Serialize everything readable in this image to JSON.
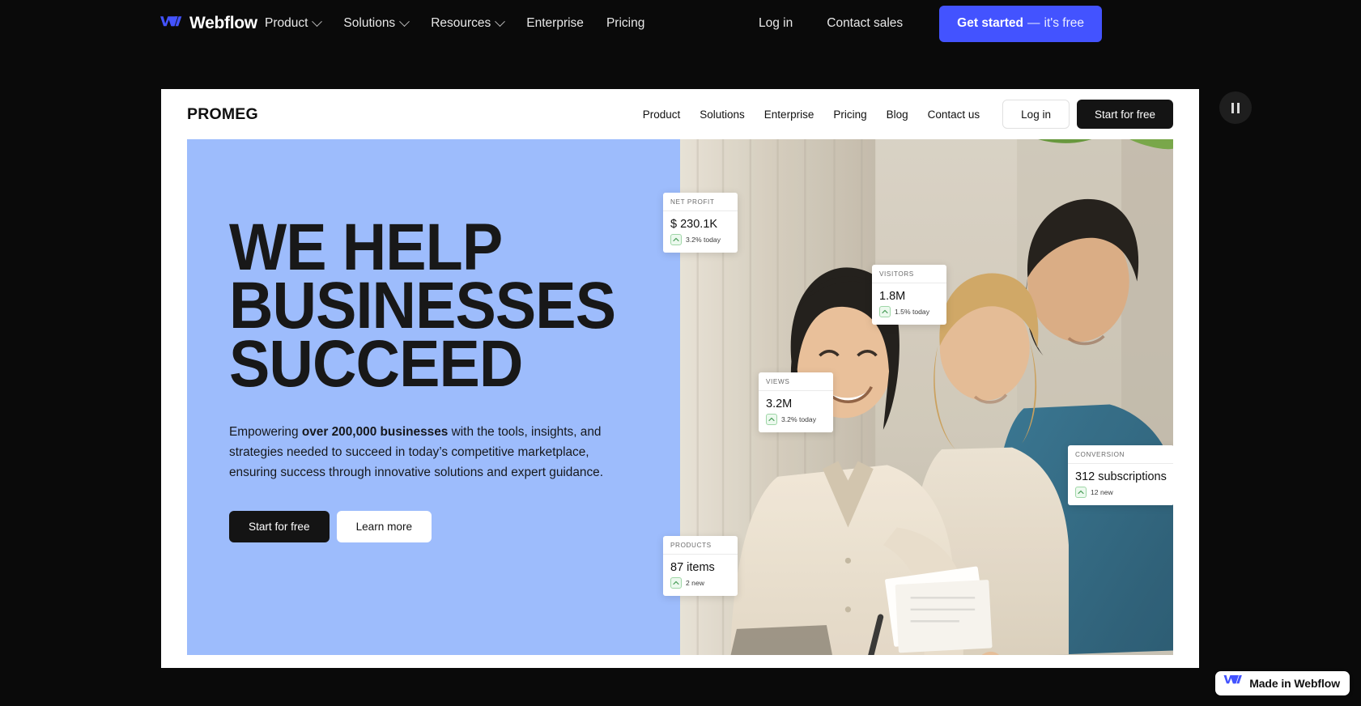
{
  "webflow_nav": {
    "logo_text": "Webflow",
    "links": [
      {
        "label": "Product",
        "has_chevron": true
      },
      {
        "label": "Solutions",
        "has_chevron": true
      },
      {
        "label": "Resources",
        "has_chevron": true
      },
      {
        "label": "Enterprise",
        "has_chevron": false
      },
      {
        "label": "Pricing",
        "has_chevron": false
      }
    ],
    "login_label": "Log in",
    "contact_label": "Contact sales",
    "cta_bold": "Get started",
    "cta_dash": "—",
    "cta_rest": "it's free",
    "accent_color": "#4353ff",
    "bar_color": "#0a0a0a"
  },
  "player": {
    "pause_label": "Pause preview",
    "icon": "pause-icon"
  },
  "site": {
    "brand": "PROMEG",
    "nav": [
      {
        "label": "Product"
      },
      {
        "label": "Solutions"
      },
      {
        "label": "Enterprise"
      },
      {
        "label": "Pricing"
      },
      {
        "label": "Blog"
      },
      {
        "label": "Contact us"
      }
    ],
    "login_label": "Log in",
    "start_label": "Start for free",
    "hero": {
      "title_lines": [
        "WE HELP",
        "BUSINESSES",
        "SUCCEED"
      ],
      "paragraph_pre": "Empowering ",
      "paragraph_bold": "over 200,000 businesses",
      "paragraph_post": " with the tools, insights, and strategies needed to succeed in today’s competitive marketplace, ensuring success through innovative solutions and expert guidance.",
      "primary_btn": "Start for free",
      "secondary_btn": "Learn more",
      "bg_color": "#9dbcfc"
    },
    "stat_cards": [
      {
        "label": "NET PROFIT",
        "value": "$ 230.1K",
        "delta": "3.2% today",
        "trend": "up"
      },
      {
        "label": "VISITORS",
        "value": "1.8M",
        "delta": "1.5% today",
        "trend": "up"
      },
      {
        "label": "VIEWS",
        "value": "3.2M",
        "delta": "3.2% today",
        "trend": "up"
      },
      {
        "label": "CONVERSION",
        "value": "312 subscriptions",
        "delta": "12 new",
        "trend": "up"
      },
      {
        "label": "PRODUCTS",
        "value": "87 items",
        "delta": "2 new",
        "trend": "up"
      }
    ]
  },
  "badge": {
    "text": "Made in Webflow",
    "icon": "webflow-logo-icon"
  }
}
